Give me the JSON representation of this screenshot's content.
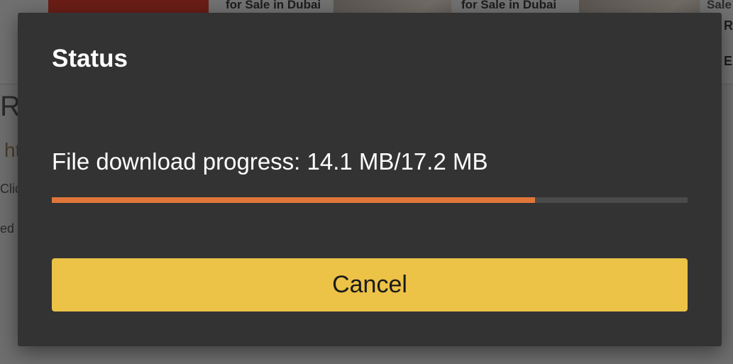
{
  "background": {
    "card_titles": [
      "for Sale in Dubai",
      "for Sale in Dubai",
      "Sale"
    ],
    "fragments": {
      "heading": "Re",
      "link": "ht",
      "text_1": "Clic",
      "text_2": "ed",
      "right_1": "R",
      "right_2": "E"
    }
  },
  "dialog": {
    "title": "Status",
    "progress_label": "File download progress: 14.1 MB/17.2 MB",
    "progress_fraction": 0.76,
    "cancel_label": "Cancel"
  },
  "colors": {
    "dialog_bg": "#333333",
    "progress_fill": "#e0773a",
    "progress_track": "#4a4a4a",
    "button_bg": "#ecc247"
  }
}
